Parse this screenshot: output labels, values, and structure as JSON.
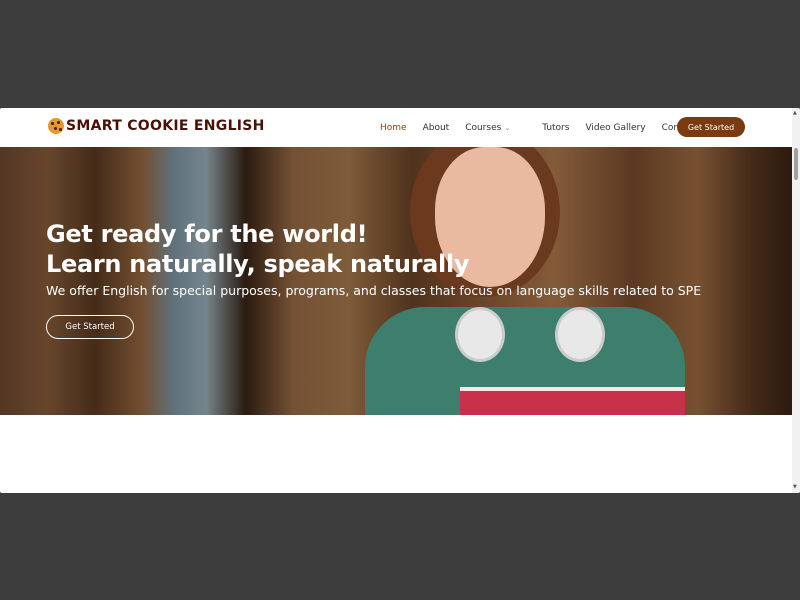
{
  "brand": {
    "name": "SMART COOKIE ENGLISH",
    "logo_icon": "cookie-icon"
  },
  "nav": {
    "items": [
      {
        "label": "Home",
        "active": true
      },
      {
        "label": "About"
      },
      {
        "label": "Courses",
        "dropdown": true
      },
      {
        "label": "Tutors"
      },
      {
        "label": "Video Gallery"
      },
      {
        "label": "Contact"
      }
    ],
    "cta": "Get Started",
    "accent": "#7b3a10"
  },
  "hero": {
    "line1": "Get ready for the world!",
    "line2": "Learn naturally, speak naturally",
    "subtitle": "We offer English for special purposes, programs, and classes that focus on language skills related to SPE",
    "button": "Get Started"
  }
}
